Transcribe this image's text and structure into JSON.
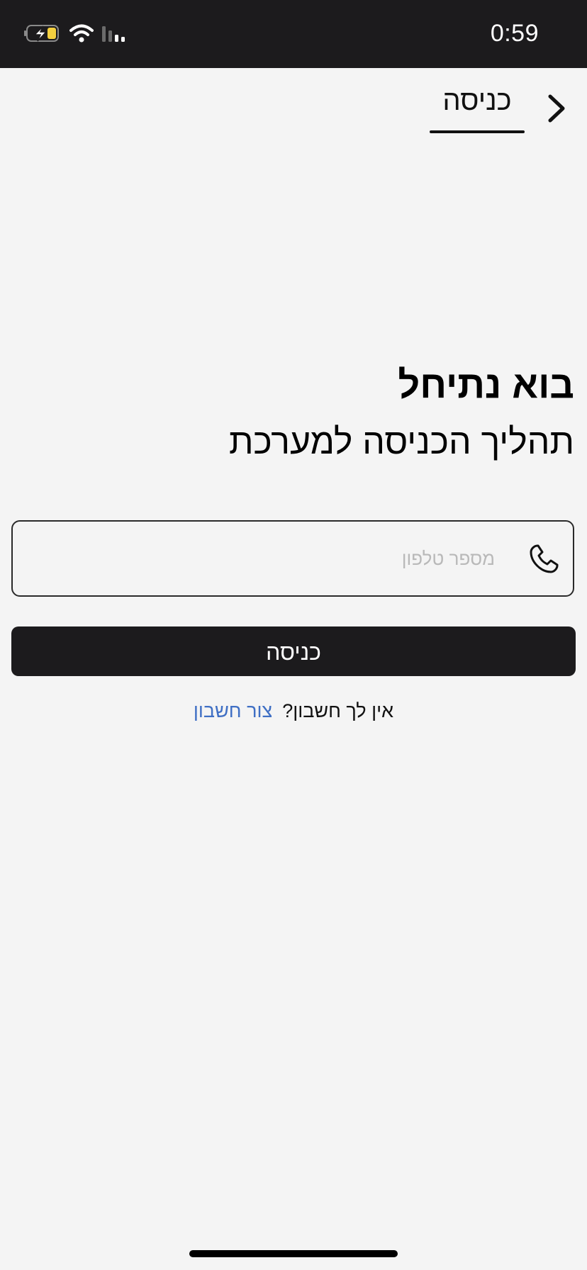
{
  "status_bar": {
    "time": "0:59",
    "icons": [
      "battery-charging-icon",
      "wifi-icon",
      "cellular-signal-icon"
    ]
  },
  "header": {
    "tab_title": "כניסה",
    "back_icon": "chevron-right-icon"
  },
  "main": {
    "heading": "בוא נתיחל",
    "subheading": "תהליך הכניסה למערכת",
    "phone_field": {
      "placeholder": "מספר טלפון",
      "value": "",
      "icon": "phone-icon"
    },
    "login_button_label": "כניסה",
    "signup_question": "אין לך חשבון?",
    "signup_link": "צור חשבון"
  },
  "colors": {
    "status_bar_bg": "#1c1b1d",
    "background": "#f4f4f4",
    "button_bg": "#1c1b1d",
    "link": "#3f6fc4",
    "battery_fill": "#f4d03f"
  }
}
